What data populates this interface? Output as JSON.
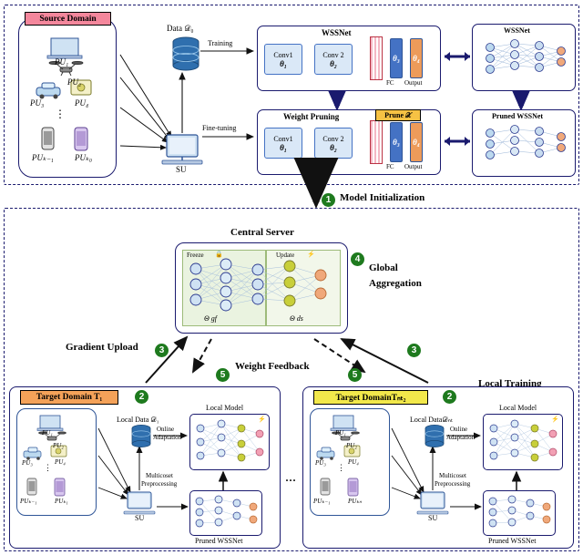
{
  "top_section": {
    "source_domain_label": "Source Domain",
    "pu_labels": [
      "PU₁",
      "PU₂",
      "PU₃",
      "PU₄",
      "PUₖ₋₁",
      "PUₖ₀"
    ],
    "dots": "⋮",
    "data_label": "Data 𝒟₀",
    "training_label": "Training",
    "finetuning_label": "Fine-tuning",
    "su_label": "SU",
    "wssnet_title": "WSSNet",
    "weight_pruning_title": "Weight Pruning",
    "conv1_label": "Conv1",
    "conv2_label": "Conv 2",
    "theta1": "θ₁",
    "theta2": "θ₂",
    "theta3": "θ₃",
    "theta4": "θ₄",
    "fc_label": "FC",
    "output_label": "Output",
    "prune_label": "Prune 𝒳",
    "right_wssnet_label": "WSSNet",
    "right_pruned_label": "Pruned WSSNet"
  },
  "step_labels": {
    "step1": "1",
    "step2": "2",
    "step3": "3",
    "step4": "4",
    "step5": "5",
    "model_initialization": "Model Initialization",
    "global_aggregation": "Global\nAggregation",
    "global_aggregation_line1": "Global",
    "global_aggregation_line2": "Aggregation",
    "gradient_upload": "Gradient Upload",
    "weight_feedback": "Weight Feedback",
    "local_training": "Local Training"
  },
  "central_server": {
    "title": "Central Server",
    "freeze_label": "Freeze",
    "update_label": "Update",
    "theta_gf": "Θ gf",
    "theta_ds": "Θ ds"
  },
  "target_left": {
    "title": "Target Domain T₁",
    "pu_labels": [
      "PU₁",
      "PU₂",
      "PU₃",
      "PU₄",
      "PUₖ₋₁",
      "PUₖ₁"
    ],
    "local_data": "Local Data 𝒟₁",
    "online_adaptation_line1": "Online",
    "online_adaptation_line2": "Adaptation",
    "local_model": "Local Model",
    "multicoset_line1": "Multicoset",
    "multicoset_line2": "Preprocessing",
    "su_label": "SU",
    "pruned_wssnet": "Pruned WSSNet"
  },
  "target_right": {
    "title": "Target DomainTₙₜ₂",
    "pu_labels": [
      "PU₁",
      "PU₂",
      "PU₃",
      "PU₄",
      "PUₖ₋₁",
      "PUₖₙ"
    ],
    "local_data": "Local Data𝒟ₙₜ",
    "online_adaptation_line1": "Online",
    "online_adaptation_line2": "Adaptation",
    "local_model": "Local Model",
    "multicoset_line1": "Multicoset",
    "multicoset_line2": "Preprocessing",
    "su_label": "SU",
    "pruned_wssnet": "Pruned WSSNet"
  },
  "ellipsis": "···",
  "colors": {
    "border_navy": "#1a1a6e",
    "source_tag": "#f4879c",
    "target_tag_left": "#f4a259",
    "target_tag_right": "#f2e84b",
    "prune_tag": "#f6c244",
    "step_green": "#1e7a1e",
    "conv_blue": "#dae8f7",
    "panel_green": "#eaf3e0"
  }
}
